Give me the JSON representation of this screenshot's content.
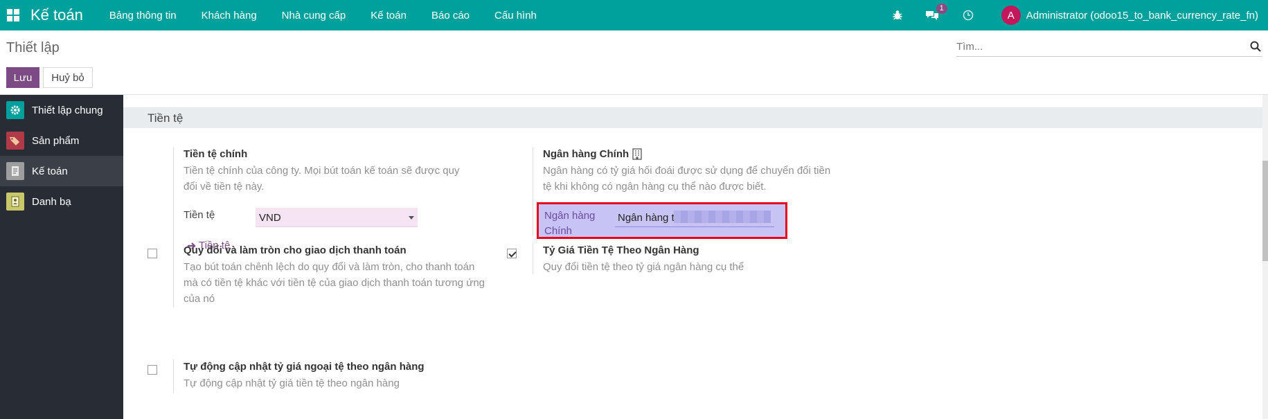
{
  "navbar": {
    "brand": "Kế toán",
    "menu": [
      "Bảng thông tin",
      "Khách hàng",
      "Nhà cung cấp",
      "Kế toán",
      "Báo cáo",
      "Cấu hình"
    ],
    "messages_badge": "1",
    "avatar_letter": "A",
    "user": "Administrator (odoo15_to_bank_currency_rate_fn)",
    "bg_color": "#00a09d"
  },
  "control_panel": {
    "title": "Thiết lập",
    "search_placeholder": "Tìm...",
    "save_label": "Lưu",
    "cancel_label": "Huỷ bỏ"
  },
  "sidebar": {
    "items": [
      {
        "label": "Thiết lập chung",
        "icon": "gear-icon",
        "color": "#00a09d"
      },
      {
        "label": "Sản phẩm",
        "icon": "tag-icon",
        "color": "#c0392b"
      },
      {
        "label": "Kế toán",
        "icon": "invoice-icon",
        "color": "#9e9e9e"
      },
      {
        "label": "Danh bạ",
        "icon": "contacts-icon",
        "color": "#c8c86a"
      }
    ],
    "active_index": 2
  },
  "section": {
    "title": "Tiền tệ",
    "main_currency": {
      "title": "Tiền tệ chính",
      "desc": "Tiền tệ chính của công ty. Mọi bút toán kế toán sẽ được quy đổi về tiền tệ này.",
      "field_label": "Tiền tệ",
      "value": "VND",
      "link": "Tiền tệ"
    },
    "main_bank": {
      "title": "Ngân hàng Chính",
      "desc": "Ngân hàng có tỷ giá hối đoái được sử dụng để chuyển đổi tiền tệ khi không có ngân hàng cụ thể nào được biết.",
      "field_label_line1": "Ngân hàng",
      "field_label_line2": "Chính",
      "value": "Ngân hàng t"
    },
    "rounding": {
      "title": "Quy đổi và làm tròn cho giao dịch thanh toán",
      "desc": "Tạo bút toán chênh lệch do quy đổi và làm tròn, cho thanh toán mà có tiền tệ khác với tiền tệ của giao dịch thanh toán tương ứng của nó",
      "checked": false
    },
    "bank_rate": {
      "title": "Tỷ Giá Tiền Tệ Theo Ngân Hàng",
      "desc": "Quy đổi tiền tệ theo tỷ giá ngân hàng cụ thể",
      "checked": true
    },
    "auto_update": {
      "title": "Tự động cập nhật tỷ giá ngoại tệ theo ngân hàng",
      "desc": "Tự động cập nhật tỷ giá tiền tệ theo ngân hàng",
      "checked": false
    }
  }
}
